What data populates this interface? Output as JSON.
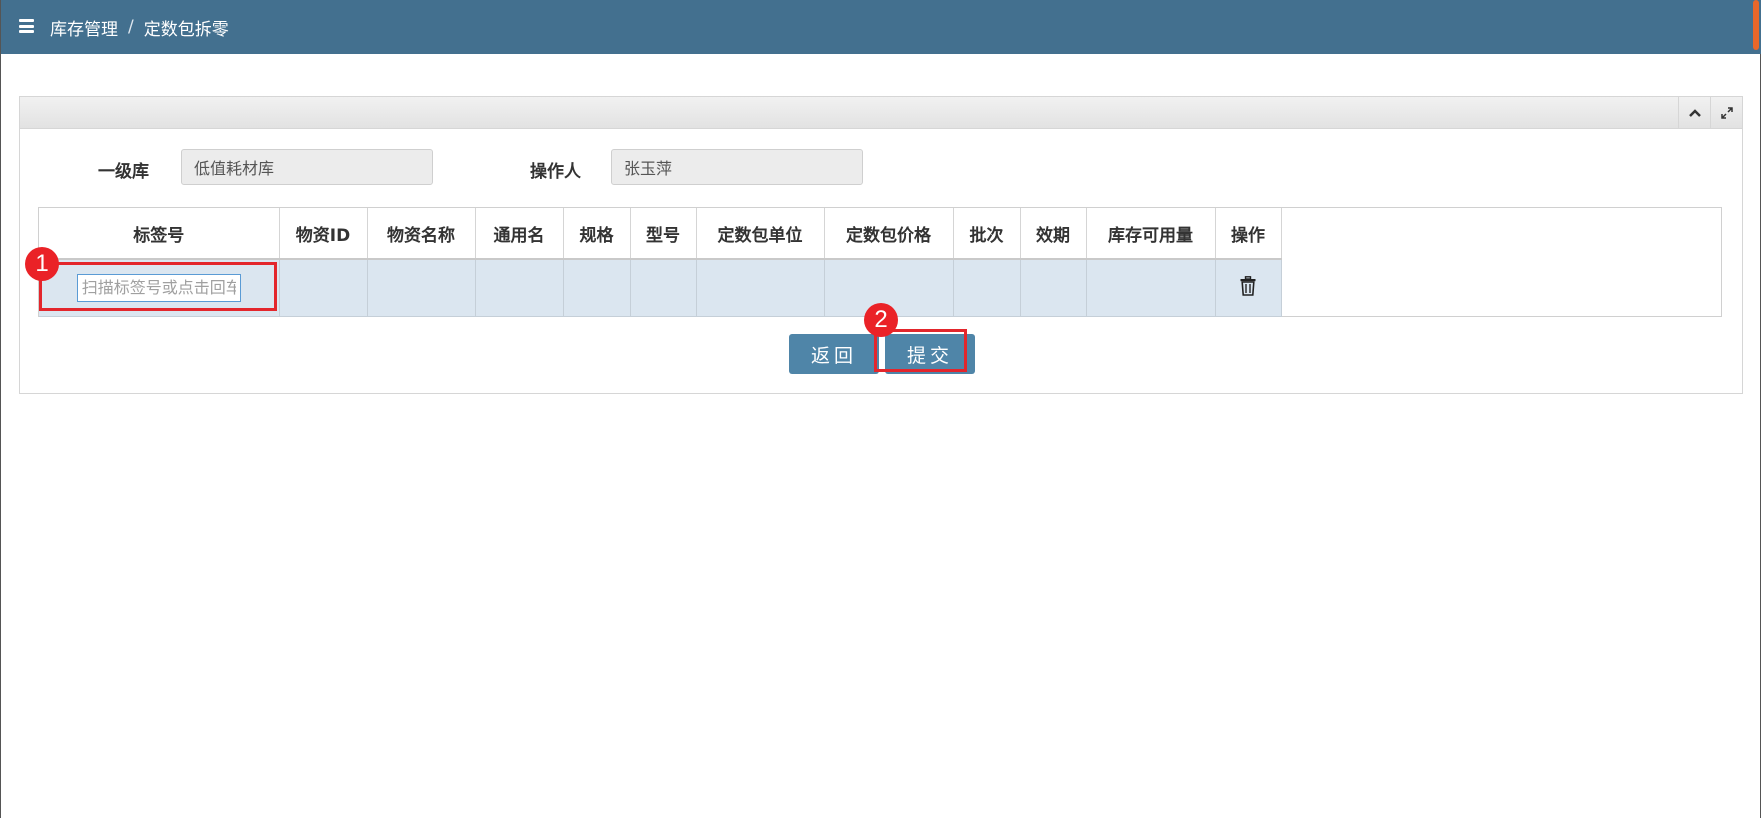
{
  "breadcrumb": {
    "items": [
      "库存管理",
      "定数包拆零"
    ],
    "separator": "/"
  },
  "form": {
    "warehouse_label": "一级库",
    "warehouse_value": "低值耗材库",
    "operator_label": "操作人",
    "operator_value": "张玉萍"
  },
  "table": {
    "columns": [
      "标签号",
      "物资ID",
      "物资名称",
      "通用名",
      "规格",
      "型号",
      "定数包单位",
      "定数包价格",
      "批次",
      "效期",
      "库存可用量",
      "操作"
    ],
    "tag_placeholder": "扫描标签号或点击回车"
  },
  "buttons": {
    "back": "返回",
    "submit": "提交"
  },
  "annotations": {
    "marker_1": "1",
    "marker_2": "2",
    "color": "#e3262c"
  },
  "colors": {
    "topbar": "#43708f",
    "button": "#4f85a8",
    "row_bg": "#dbe6f0"
  },
  "icons": {
    "menu": "hamburger-icon",
    "collapse": "chevron-up-icon",
    "expand": "fullscreen-icon",
    "delete": "trash-icon"
  }
}
